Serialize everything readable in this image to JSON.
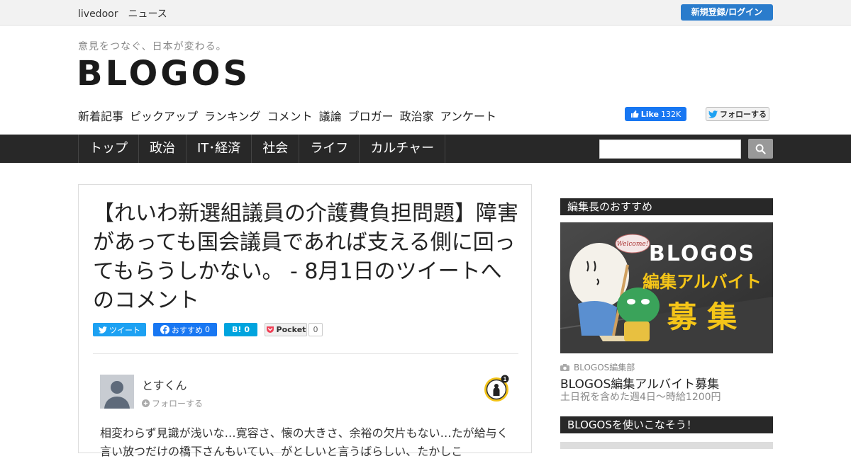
{
  "topbar": {
    "brand": "livedoor　ニュース",
    "login_label": "新規登録/ログイン"
  },
  "header": {
    "tagline": "意見をつなぐ、日本が変わる。",
    "logo": "BLOGOS",
    "nav": [
      "新着記事",
      "ピックアップ",
      "ランキング",
      "コメント",
      "議論",
      "ブロガー",
      "政治家",
      "アンケート"
    ],
    "fb_like_label": "Like",
    "fb_like_count": "132K",
    "twitter_follow_label": "フォローする"
  },
  "categories": [
    "トップ",
    "政治",
    "IT･経済",
    "社会",
    "ライフ",
    "カルチャー"
  ],
  "search": {
    "placeholder": ""
  },
  "article": {
    "title": "【れいわ新選組議員の介護費負担問題】障害があっても国会議員であれば支える側に回ってもらうしかない。 - 8月1日のツイートへのコメント",
    "share": {
      "tweet_label": "ツイート",
      "fb_label": "おすすめ",
      "fb_count": "0",
      "hatena_count": "0",
      "pocket_label": "Pocket",
      "pocket_count": "0"
    },
    "author": "とすくん",
    "follow_label": "フォローする",
    "badge_count": "1",
    "body": "相変わらず見識が浅いな…寛容さ、懐の大きさ、余裕の欠片もない…たが給与く言い放つだけの橋下さんもいてい、がとしいと言うばらしい、たかしこ"
  },
  "sidebar": {
    "editor_pick_heading": "編集長のおすすめ",
    "promo": {
      "logo": "BLOGOS",
      "line1": "編集アルバイト",
      "line2": "募 集",
      "bubble": "Welcome!"
    },
    "source": "BLOGOS編集部",
    "pick_title": "BLOGOS編集アルバイト募集",
    "pick_sub": "土日祝を含めた週4日〜時給1200円",
    "howto_heading": "BLOGOSを使いこなそう！"
  },
  "colors": {
    "accent_blue": "#2a7ccc",
    "dark_bar": "#282828",
    "promo_yellow": "#f5c518"
  }
}
